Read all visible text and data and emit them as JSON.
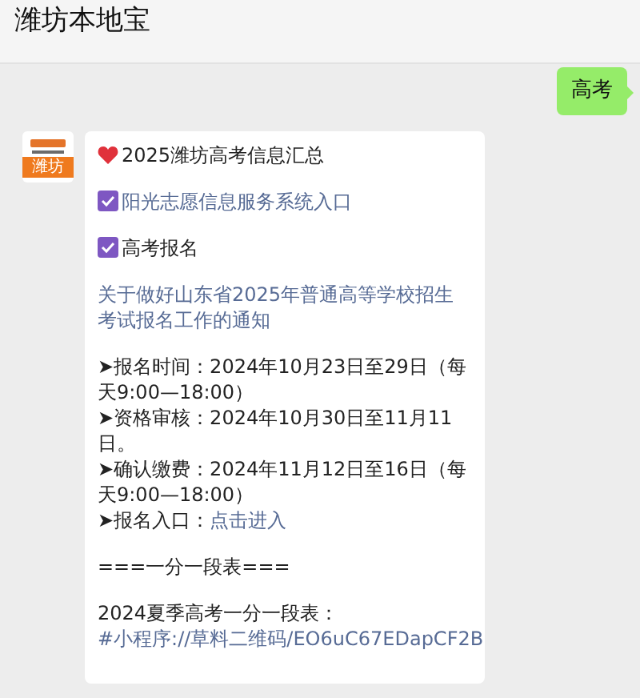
{
  "header": {
    "title": "潍坊本地宝"
  },
  "messages": [
    {
      "kind": "sent",
      "text": "高考"
    },
    {
      "kind": "received",
      "avatar": {
        "label": "潍坊"
      },
      "paragraphs": [
        {
          "kind": "heading",
          "text": "2025潍坊高考信息汇总"
        },
        {
          "kind": "check",
          "text": "阳光志愿信息服务系统入口",
          "link": true
        },
        {
          "kind": "check",
          "text": "高考报名",
          "link": false
        },
        {
          "kind": "link",
          "text": "关于做好山东省2025年普通高等学校招生考试报名工作的通知"
        },
        {
          "kind": "bullets",
          "items": [
            {
              "text": "➤报名时间：2024年10月23日至29日（每天9:00—18:00）"
            },
            {
              "text": "➤资格审核：2024年10月30日至11月11日。"
            },
            {
              "text": "➤确认缴费：2024年11月12日至16日（每天9:00—18:00）"
            },
            {
              "text": "➤报名入口：",
              "link": "点击进入"
            }
          ]
        },
        {
          "kind": "plain",
          "text": "===一分一段表==="
        },
        {
          "kind": "plain",
          "text": "2024夏季高考一分一段表：",
          "link": "#小程序://草料二维码/EO6uC67EDapCF2B"
        }
      ]
    }
  ]
}
